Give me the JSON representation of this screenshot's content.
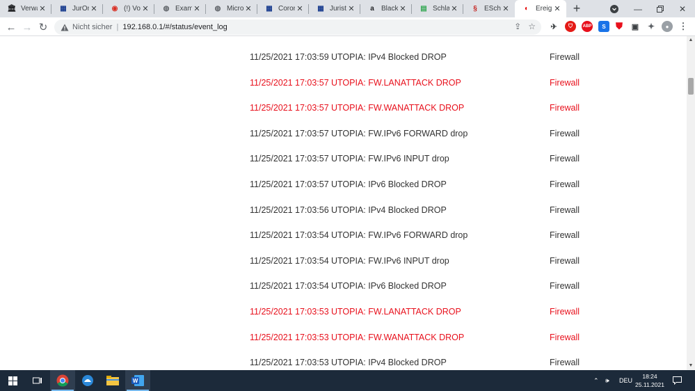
{
  "browser": {
    "tabs": [
      {
        "title": "Verwalt",
        "icon": "bank-icon"
      },
      {
        "title": "JurOnli",
        "icon": "juris-icon"
      },
      {
        "title": "(!) Vorl",
        "icon": "spinner-icon"
      },
      {
        "title": "Examin",
        "icon": "globe-icon"
      },
      {
        "title": "Micros",
        "icon": "globe-icon"
      },
      {
        "title": "Corona",
        "icon": "juris-icon"
      },
      {
        "title": "Juristis",
        "icon": "juris-icon"
      },
      {
        "title": "Black F",
        "icon": "amazon-icon"
      },
      {
        "title": "Schlafz",
        "icon": "sheet-icon"
      },
      {
        "title": "ESchG",
        "icon": "law-icon"
      },
      {
        "title": "Ereign",
        "icon": "vodafone-icon",
        "active": true
      }
    ],
    "address": {
      "security_label": "Nicht sicher",
      "url": "192.168.0.1/#/status/event_log"
    },
    "extensions": {
      "abp_label": "ABP"
    }
  },
  "event_log": {
    "rows": [
      {
        "date": "11/25/2021",
        "time": "17:03:59",
        "message": "UTOPIA: IPv4 Blocked DROP",
        "source": "Firewall",
        "alert": false
      },
      {
        "date": "11/25/2021",
        "time": "17:03:57",
        "message": "UTOPIA: FW.LANATTACK DROP",
        "source": "Firewall",
        "alert": true
      },
      {
        "date": "11/25/2021",
        "time": "17:03:57",
        "message": "UTOPIA: FW.WANATTACK DROP",
        "source": "Firewall",
        "alert": true
      },
      {
        "date": "11/25/2021",
        "time": "17:03:57",
        "message": "UTOPIA: FW.IPv6 FORWARD drop",
        "source": "Firewall",
        "alert": false
      },
      {
        "date": "11/25/2021",
        "time": "17:03:57",
        "message": "UTOPIA: FW.IPv6 INPUT drop",
        "source": "Firewall",
        "alert": false
      },
      {
        "date": "11/25/2021",
        "time": "17:03:57",
        "message": "UTOPIA: IPv6 Blocked DROP",
        "source": "Firewall",
        "alert": false
      },
      {
        "date": "11/25/2021",
        "time": "17:03:56",
        "message": "UTOPIA: IPv4 Blocked DROP",
        "source": "Firewall",
        "alert": false
      },
      {
        "date": "11/25/2021",
        "time": "17:03:54",
        "message": "UTOPIA: FW.IPv6 FORWARD drop",
        "source": "Firewall",
        "alert": false
      },
      {
        "date": "11/25/2021",
        "time": "17:03:54",
        "message": "UTOPIA: FW.IPv6 INPUT drop",
        "source": "Firewall",
        "alert": false
      },
      {
        "date": "11/25/2021",
        "time": "17:03:54",
        "message": "UTOPIA: IPv6 Blocked DROP",
        "source": "Firewall",
        "alert": false
      },
      {
        "date": "11/25/2021",
        "time": "17:03:53",
        "message": "UTOPIA: FW.LANATTACK DROP",
        "source": "Firewall",
        "alert": true
      },
      {
        "date": "11/25/2021",
        "time": "17:03:53",
        "message": "UTOPIA: FW.WANATTACK DROP",
        "source": "Firewall",
        "alert": true
      },
      {
        "date": "11/25/2021",
        "time": "17:03:53",
        "message": "UTOPIA: IPv4 Blocked DROP",
        "source": "Firewall",
        "alert": false
      }
    ],
    "colors": {
      "normal": "#333333",
      "alert": "#e8101c"
    }
  },
  "taskbar": {
    "language": "DEU",
    "time": "18:24",
    "date": "25.11.2021"
  }
}
